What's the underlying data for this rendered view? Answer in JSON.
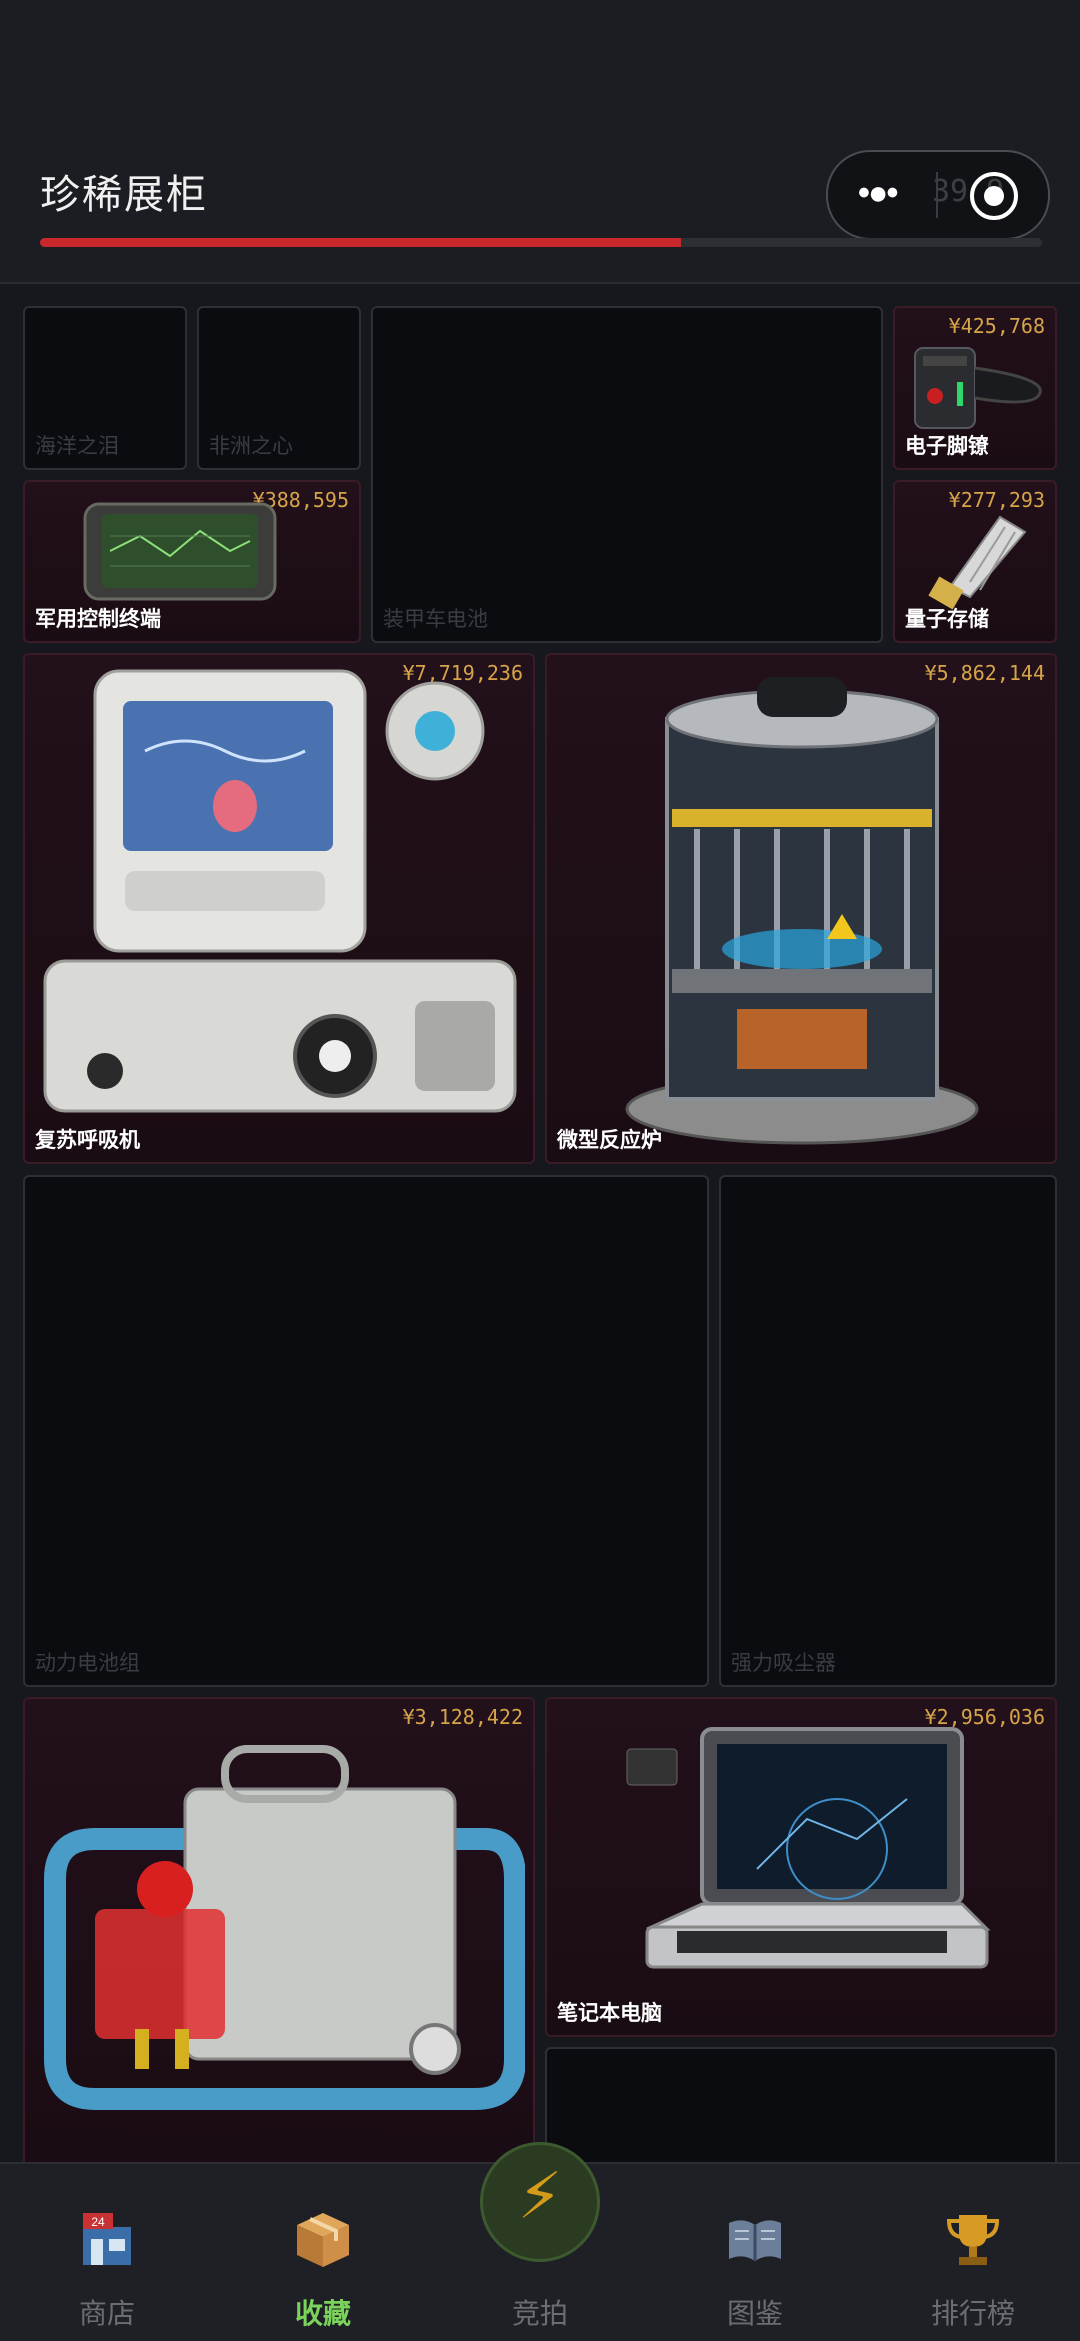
{
  "header": {
    "title": "珍稀展柜",
    "capsule_ghost_text": "39 9",
    "progress_fraction": 0.64
  },
  "exhibits": [
    {
      "id": "haiyang",
      "name": "海洋之泪",
      "owned": false
    },
    {
      "id": "feizhou",
      "name": "非洲之心",
      "owned": false
    },
    {
      "id": "zhuangjia",
      "name": "装甲车电池",
      "owned": false
    },
    {
      "id": "jiaoliao",
      "name": "电子脚镣",
      "owned": true,
      "price": "¥425,768"
    },
    {
      "id": "junyong",
      "name": "军用控制终端",
      "owned": true,
      "price": "¥388,595"
    },
    {
      "id": "liangzi",
      "name": "量子存储",
      "owned": true,
      "price": "¥277,293"
    },
    {
      "id": "husu",
      "name": "复苏呼吸机",
      "owned": true,
      "price": "¥7,719,236"
    },
    {
      "id": "weixing",
      "name": "微型反应炉",
      "owned": true,
      "price": "¥5,862,144"
    },
    {
      "id": "dongli",
      "name": "动力电池组",
      "owned": false
    },
    {
      "id": "xichen",
      "name": "强力吸尘器",
      "owned": false
    },
    {
      "id": "fadian",
      "name": "",
      "owned": true,
      "price": "¥3,128,422"
    },
    {
      "id": "bijiben",
      "name": "笔记本电脑",
      "owned": true,
      "price": "¥2,956,036"
    },
    {
      "id": "unknown",
      "name": "",
      "owned": false
    }
  ],
  "tabbar": {
    "shop": "商店",
    "collection": "收藏",
    "auction": "竞拍",
    "atlas": "图鉴",
    "ranking": "排行榜",
    "shop_badge": "24",
    "active": "collection"
  },
  "colors": {
    "accent_red": "#c8282b",
    "price_gold": "#d7a44a",
    "active_green": "#7bd35c"
  }
}
